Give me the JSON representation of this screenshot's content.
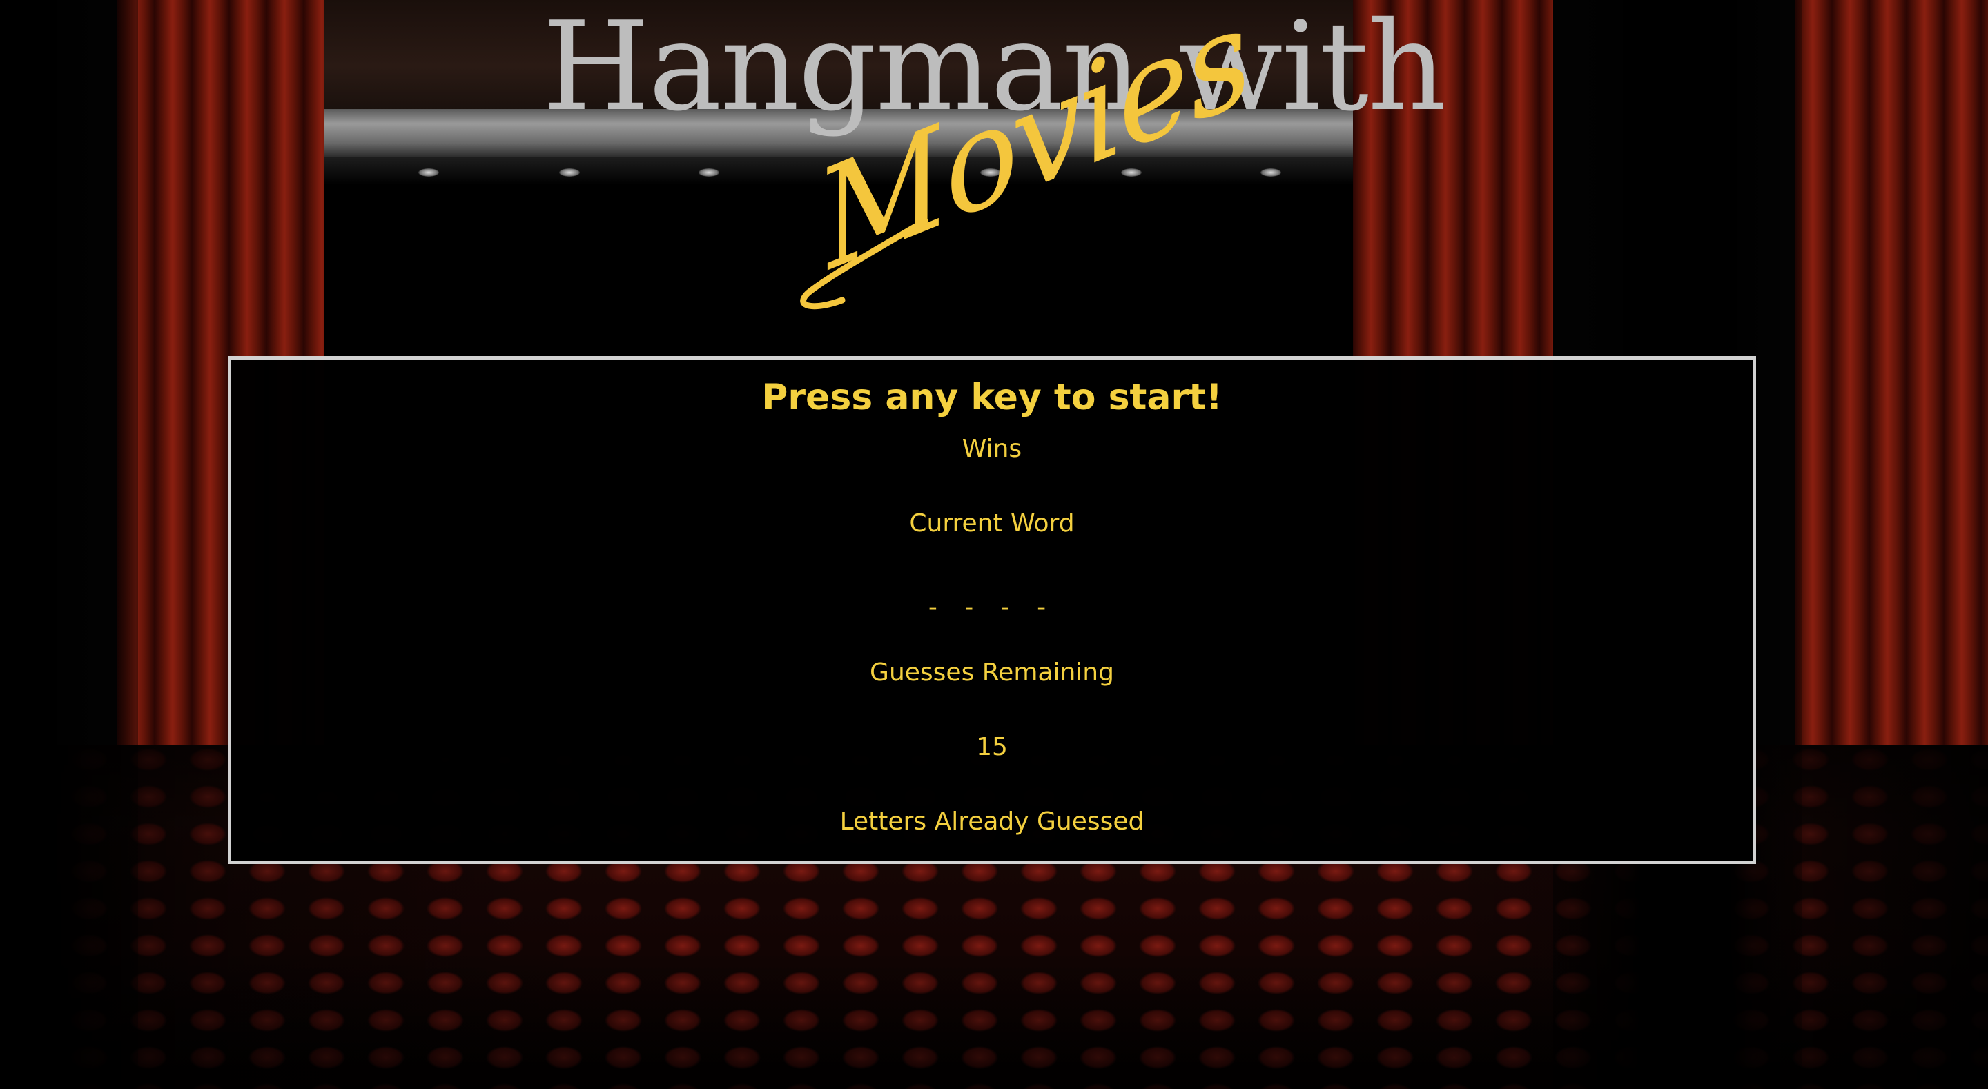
{
  "title": {
    "main": "Hangman with",
    "sub": "Movies"
  },
  "game": {
    "prompt": "Press any key to start!",
    "wins_label": "Wins",
    "current_word_label": "Current Word",
    "current_word_value": "- - - -",
    "guesses_remaining_label": "Guesses Remaining",
    "guesses_remaining_value": "15",
    "letters_guessed_label": "Letters Already Guessed"
  },
  "colors": {
    "accent": "#f4d03f",
    "title_gray": "#bdbdbd",
    "panel_border": "#d2d2d2",
    "curtain_red": "#8a1f10"
  }
}
